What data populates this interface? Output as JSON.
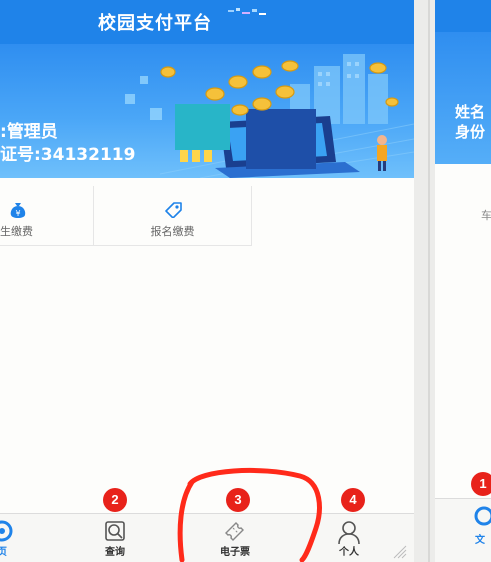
{
  "header": {
    "title": "校园支付平台"
  },
  "banner": {
    "role_line": "管理员",
    "id_line": "证号:34132119"
  },
  "quick_actions": [
    {
      "label": "生缴费",
      "icon": "money-bag-icon"
    },
    {
      "label": "报名缴费",
      "icon": "tag-icon"
    }
  ],
  "tabbar": [
    {
      "label": "",
      "icon": "home-icon",
      "badge": "1"
    },
    {
      "label": "查询",
      "icon": "search-doc-icon",
      "badge": "2"
    },
    {
      "label": "电子票",
      "icon": "ticket-icon",
      "badge": "3"
    },
    {
      "label": "个人",
      "icon": "user-icon",
      "badge": "4"
    }
  ],
  "right_panel": {
    "name_line": "姓名",
    "id_line": "身份",
    "quick_label": "车",
    "tab_label": "文",
    "badge": "1"
  },
  "colors": {
    "brand": "#1f83e9",
    "badge": "#e8221a",
    "highlight": "#ff2a1a"
  }
}
